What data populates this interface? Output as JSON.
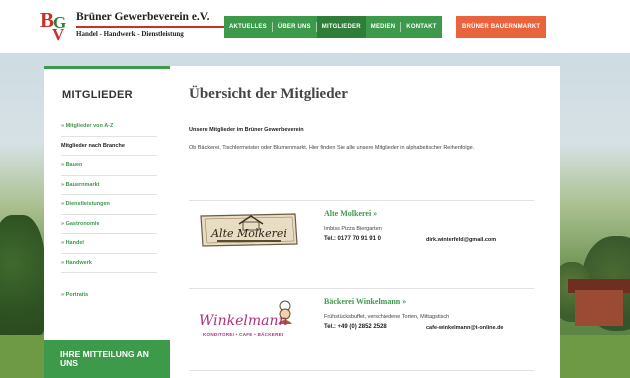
{
  "header": {
    "logo": {
      "title": "Brüner Gewerbeverein e.V.",
      "subtitle": "Handel - Handwerk - Dienstleistung",
      "letters": [
        "B",
        "G",
        "V"
      ]
    },
    "nav": [
      {
        "label": "AKTUELLES",
        "active": false
      },
      {
        "label": "ÜBER UNS",
        "active": false
      },
      {
        "label": "MITGLIEDER",
        "active": true
      },
      {
        "label": "MEDIEN",
        "active": false
      },
      {
        "label": "KONTAKT",
        "active": false
      }
    ],
    "cta_label": "BRÜNER BAUERNMARKT"
  },
  "sidebar": {
    "title": "MITGLIEDER",
    "items": [
      {
        "label": "» Mitglieder von A-Z",
        "current": false
      },
      {
        "label": "Mitglieder nach Branche",
        "current": true
      },
      {
        "label": "» Bauen",
        "current": false
      },
      {
        "label": "» Bauernmarkt",
        "current": false
      },
      {
        "label": "» Dienstleistungen",
        "current": false
      },
      {
        "label": "» Gastronomie",
        "current": false
      },
      {
        "label": "» Handel",
        "current": false
      },
      {
        "label": "» Handwerk",
        "current": false
      },
      {
        "label": "» Portraits",
        "current": false
      }
    ],
    "banner_label": "IHRE MITTEILUNG AN UNS"
  },
  "main": {
    "title": "Übersicht der Mitglieder",
    "intro_heading": "Unsere Mitglieder im Brüner Gewerbeverein",
    "intro_text": "Ob Bäckerei, Tischlermeister oder Blumenmarkt. Hier finden Sie alle unsere Mitglieder in alphabetischer Reihenfolge.",
    "members": [
      {
        "name": "Alte Molkerei »",
        "description": "Imbiss Pizza Biergarten",
        "phone": "Tel.: 0177 70 91 91 0",
        "email": "dirk.winterfeld@gmail.com",
        "logo_text": "Alte Molkerei"
      },
      {
        "name": "Bäckerei Winkelmann »",
        "description": "Frühstücksbuffet, verschiedene Torten, Mittagstisch",
        "phone": "Tel.: +49 (0) 2852 2528",
        "email": "cafe-winkelmann@t-online.de",
        "logo_text": "Winkelmann",
        "logo_subtext": "KONDITOREI • CAFE • BÄCKEREI"
      }
    ]
  },
  "colors": {
    "accent_green": "#3d9a4b",
    "active_green": "#2e7e3a",
    "cta_orange": "#e9643c",
    "logo_red": "#c8312a",
    "winkelmann_magenta": "#b0307a"
  }
}
